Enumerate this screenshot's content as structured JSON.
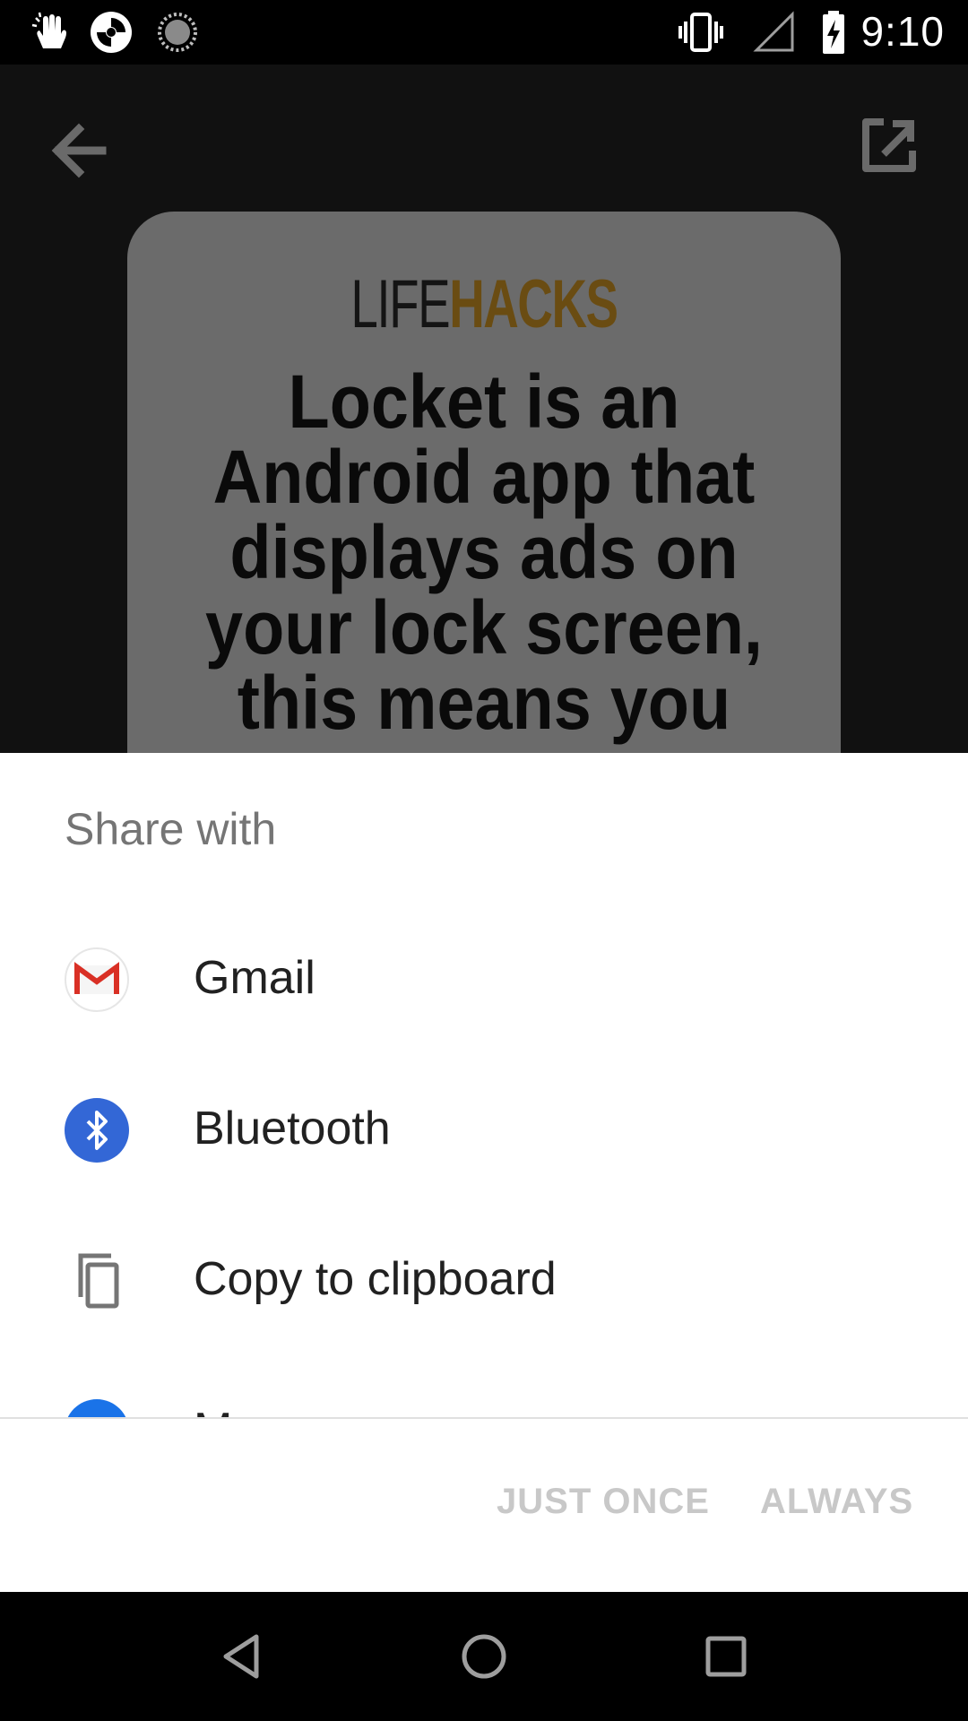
{
  "status_bar": {
    "time": "9:10",
    "left_icons": [
      "hand-icon",
      "camera-shutter-icon",
      "loading-icon"
    ],
    "right_icons": [
      "vibrate-icon",
      "signal-icon",
      "battery-charging-icon"
    ]
  },
  "app": {
    "back_icon": "arrow-left-icon",
    "share_icon": "external-share-icon",
    "card": {
      "logo_part1": "LIFE",
      "logo_part2": "HACKS",
      "text_lines": [
        "Locket is an",
        "Android app that",
        "displays ads on",
        "your lock screen,",
        "this means you get"
      ]
    }
  },
  "share_sheet": {
    "title": "Share with",
    "items": [
      {
        "label": "Gmail",
        "icon": "gmail-icon"
      },
      {
        "label": "Bluetooth",
        "icon": "bluetooth-icon"
      },
      {
        "label": "Copy to clipboard",
        "icon": "copy-icon"
      },
      {
        "label": "M",
        "icon": "messages-icon"
      }
    ],
    "actions": {
      "just_once": "JUST ONCE",
      "always": "ALWAYS"
    }
  },
  "colors": {
    "logo_accent": "#6a4c12",
    "bluetooth_blue": "#3367d6",
    "gmail_red": "#d93025",
    "disabled_text": "#c8c8c8"
  }
}
